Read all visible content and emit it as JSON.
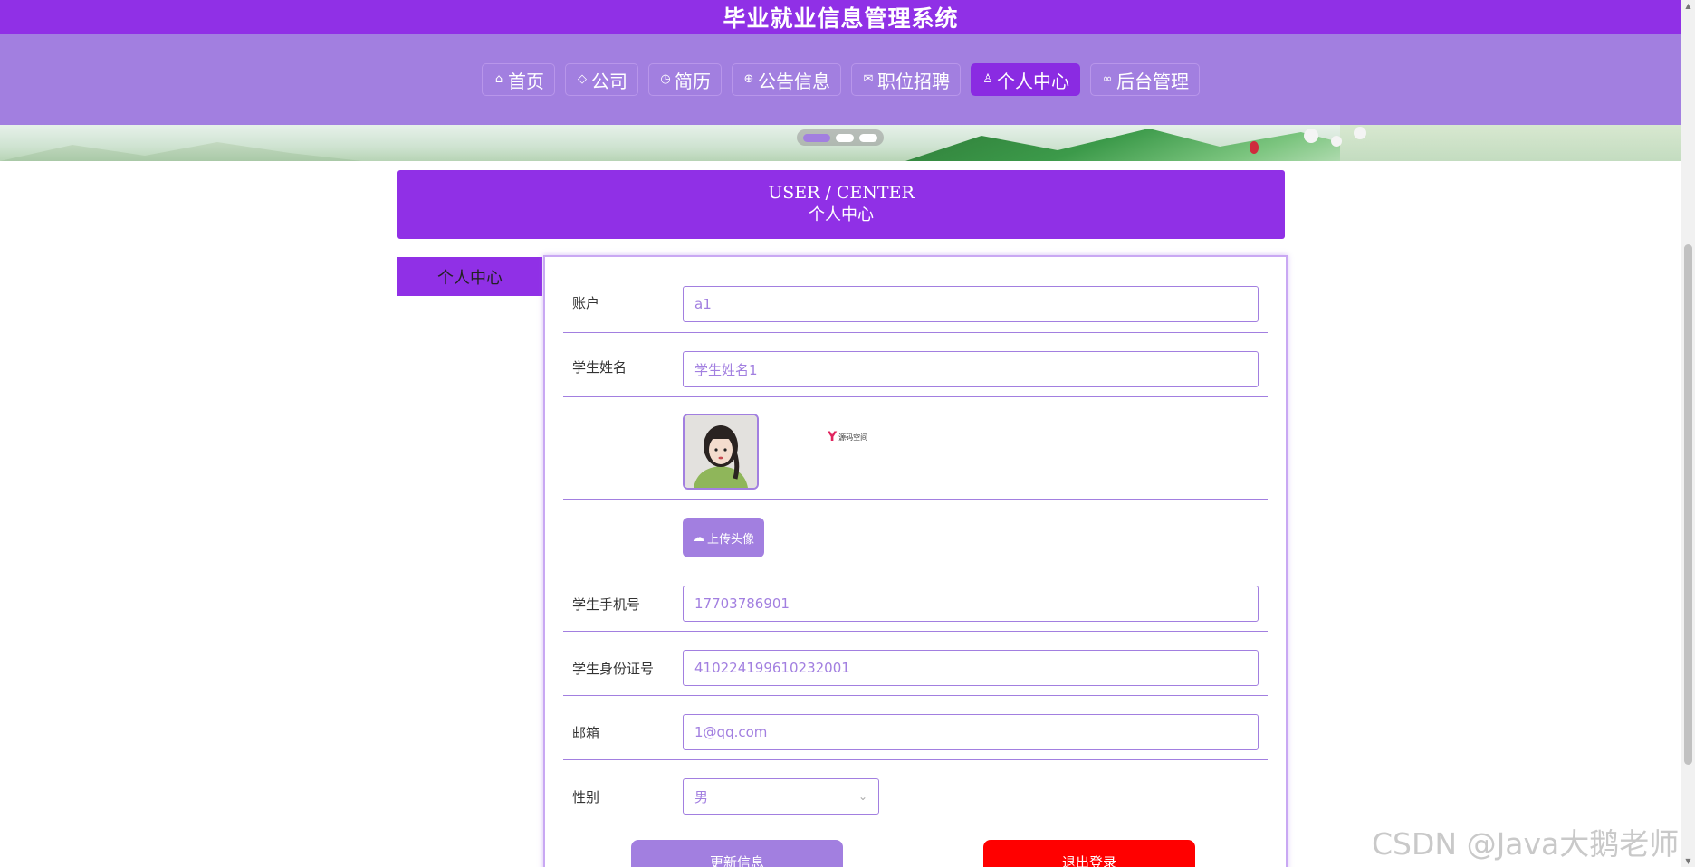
{
  "header": {
    "title": "毕业就业信息管理系统"
  },
  "nav": {
    "items": [
      {
        "label": "首页",
        "icon": "home-icon"
      },
      {
        "label": "公司",
        "icon": "tag-icon"
      },
      {
        "label": "简历",
        "icon": "clock-icon"
      },
      {
        "label": "公告信息",
        "icon": "globe-icon"
      },
      {
        "label": "职位招聘",
        "icon": "mail-icon"
      },
      {
        "label": "个人中心",
        "icon": "user-icon",
        "active": true
      },
      {
        "label": "后台管理",
        "icon": "link-icon"
      }
    ]
  },
  "banner": {
    "slides": 3,
    "active_slide": 1
  },
  "section": {
    "title_en": "USER / CENTER",
    "title_cn": "个人中心"
  },
  "sidebar": {
    "tab_label": "个人中心"
  },
  "form": {
    "account": {
      "label": "账户",
      "value": "a1"
    },
    "name": {
      "label": "学生姓名",
      "value": "学生姓名1"
    },
    "avatar": {
      "watermark_text": "源码空间"
    },
    "upload": {
      "label": "上传头像"
    },
    "phone": {
      "label": "学生手机号",
      "value": "17703786901"
    },
    "id_card": {
      "label": "学生身份证号",
      "value": "410224199610232001"
    },
    "email": {
      "label": "邮箱",
      "value": "1@qq.com"
    },
    "gender": {
      "label": "性别",
      "value": "男"
    }
  },
  "actions": {
    "update_label": "更新信息",
    "logout_label": "退出登录"
  },
  "watermark": "CSDN @Java大鹅老师",
  "colors": {
    "primary": "#9030e6",
    "nav_bg": "#a27fe0",
    "logout": "#ff0000"
  }
}
